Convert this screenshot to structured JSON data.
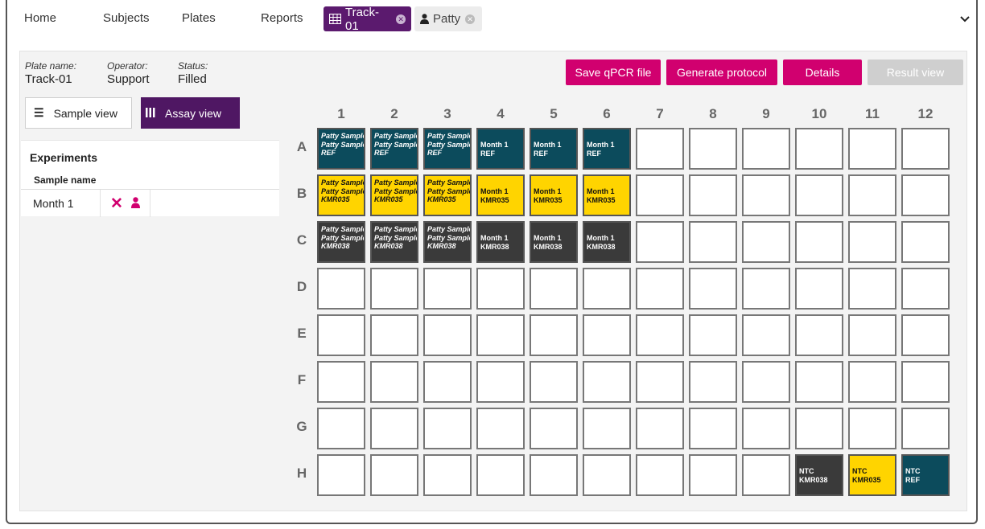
{
  "nav": {
    "items": [
      "Home",
      "Subjects",
      "Plates",
      "Reports"
    ],
    "active_tab": "Track-01",
    "second_tab": "Patty"
  },
  "plate_info": {
    "name_label": "Plate name:",
    "name_value": "Track-01",
    "operator_label": "Operator:",
    "operator_value": "Support",
    "status_label": "Status:",
    "status_value": "Filled"
  },
  "actions": {
    "save": "Save qPCR file",
    "generate": "Generate protocol",
    "details": "Details",
    "result": "Result view"
  },
  "views": {
    "sample": "Sample view",
    "assay": "Assay view"
  },
  "experiments": {
    "title": "Experiments",
    "column": "Sample name",
    "rows": [
      {
        "name": "Month 1"
      }
    ]
  },
  "plate": {
    "columns": [
      "1",
      "2",
      "3",
      "4",
      "5",
      "6",
      "7",
      "8",
      "9",
      "10",
      "11",
      "12"
    ],
    "rows": [
      "A",
      "B",
      "C",
      "D",
      "E",
      "F",
      "G",
      "H"
    ],
    "colors": {
      "teal": "#0c4b5c",
      "yellow": "#ffd400",
      "dark": "#3a3a3a"
    },
    "wells": [
      {
        "r": "A",
        "c": 1,
        "color": "teal",
        "italic": true,
        "lines": [
          "Patty Sample",
          "Patty Sample",
          "REF"
        ]
      },
      {
        "r": "A",
        "c": 2,
        "color": "teal",
        "italic": true,
        "lines": [
          "Patty Sample",
          "Patty Sample",
          "REF"
        ]
      },
      {
        "r": "A",
        "c": 3,
        "color": "teal",
        "italic": true,
        "lines": [
          "Patty Sample",
          "Patty Sample",
          "REF"
        ]
      },
      {
        "r": "A",
        "c": 4,
        "color": "teal",
        "italic": false,
        "lines": [
          "Month 1",
          "REF"
        ]
      },
      {
        "r": "A",
        "c": 5,
        "color": "teal",
        "italic": false,
        "lines": [
          "Month 1",
          "REF"
        ]
      },
      {
        "r": "A",
        "c": 6,
        "color": "teal",
        "italic": false,
        "lines": [
          "Month 1",
          "REF"
        ]
      },
      {
        "r": "B",
        "c": 1,
        "color": "yellow",
        "italic": true,
        "lines": [
          "Patty Sample",
          "Patty Sample",
          "KMR035"
        ]
      },
      {
        "r": "B",
        "c": 2,
        "color": "yellow",
        "italic": true,
        "lines": [
          "Patty Sample",
          "Patty Sample",
          "KMR035"
        ]
      },
      {
        "r": "B",
        "c": 3,
        "color": "yellow",
        "italic": true,
        "lines": [
          "Patty Sample",
          "Patty Sample",
          "KMR035"
        ]
      },
      {
        "r": "B",
        "c": 4,
        "color": "yellow",
        "italic": false,
        "lines": [
          "Month 1",
          "KMR035"
        ]
      },
      {
        "r": "B",
        "c": 5,
        "color": "yellow",
        "italic": false,
        "lines": [
          "Month 1",
          "KMR035"
        ]
      },
      {
        "r": "B",
        "c": 6,
        "color": "yellow",
        "italic": false,
        "lines": [
          "Month 1",
          "KMR035"
        ]
      },
      {
        "r": "C",
        "c": 1,
        "color": "dark",
        "italic": true,
        "lines": [
          "Patty Sample",
          "Patty Sample",
          "KMR038"
        ]
      },
      {
        "r": "C",
        "c": 2,
        "color": "dark",
        "italic": true,
        "lines": [
          "Patty Sample",
          "Patty Sample",
          "KMR038"
        ]
      },
      {
        "r": "C",
        "c": 3,
        "color": "dark",
        "italic": true,
        "lines": [
          "Patty Sample",
          "Patty Sample",
          "KMR038"
        ]
      },
      {
        "r": "C",
        "c": 4,
        "color": "dark",
        "italic": false,
        "lines": [
          "Month 1",
          "KMR038"
        ]
      },
      {
        "r": "C",
        "c": 5,
        "color": "dark",
        "italic": false,
        "lines": [
          "Month 1",
          "KMR038"
        ]
      },
      {
        "r": "C",
        "c": 6,
        "color": "dark",
        "italic": false,
        "lines": [
          "Month 1",
          "KMR038"
        ]
      },
      {
        "r": "H",
        "c": 10,
        "color": "dark",
        "italic": false,
        "lines": [
          "NTC",
          "KMR038"
        ]
      },
      {
        "r": "H",
        "c": 11,
        "color": "yellow",
        "italic": false,
        "lines": [
          "NTC",
          "KMR035"
        ]
      },
      {
        "r": "H",
        "c": 12,
        "color": "teal",
        "italic": false,
        "lines": [
          "NTC",
          "REF"
        ]
      }
    ]
  }
}
